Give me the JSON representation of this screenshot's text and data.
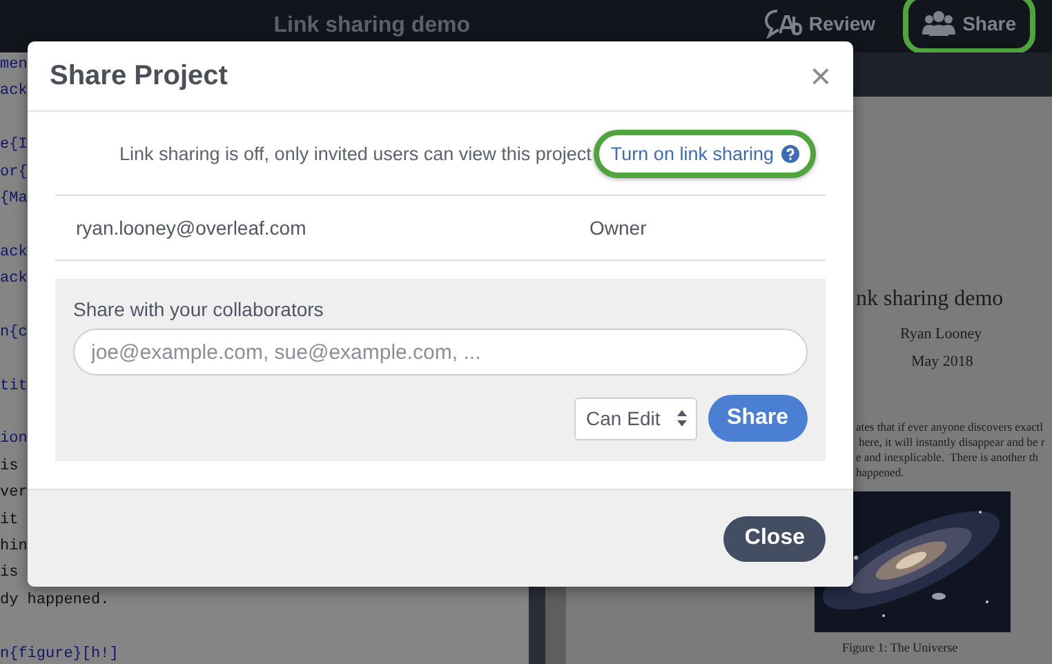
{
  "topbar": {
    "title": "Link sharing demo",
    "buttons": [
      {
        "label": "Review",
        "highlighted": false
      },
      {
        "label": "Share",
        "highlighted": true
      }
    ]
  },
  "editor": {
    "lines": [
      {
        "kind": "command",
        "text": "men"
      },
      {
        "kind": "command",
        "text": "ack"
      },
      {
        "kind": "blank"
      },
      {
        "kind": "command",
        "text": "e{I"
      },
      {
        "kind": "command",
        "text": "or{"
      },
      {
        "kind": "command",
        "text": "{Ma"
      },
      {
        "kind": "blank"
      },
      {
        "kind": "command",
        "text": "ack"
      },
      {
        "kind": "command",
        "text": "ack"
      },
      {
        "kind": "blank"
      },
      {
        "kind": "command",
        "text": "n{c"
      },
      {
        "kind": "blank"
      },
      {
        "kind": "command",
        "text": "tit"
      },
      {
        "kind": "blank"
      },
      {
        "kind": "command",
        "text": "ion"
      },
      {
        "kind": "text",
        "text": "is"
      },
      {
        "kind": "text",
        "text": "ver"
      },
      {
        "kind": "text",
        "text": "it"
      },
      {
        "kind": "text",
        "text": "hin"
      },
      {
        "kind": "text",
        "text": "is"
      },
      {
        "kind": "text",
        "text": "dy happened."
      },
      {
        "kind": "blank"
      },
      {
        "kind": "command",
        "text": "n{figure}[h!]"
      }
    ]
  },
  "pdf": {
    "title": "nk sharing demo",
    "author": "Ryan Looney",
    "date": "May 2018",
    "paragraph_lines": [
      "ates that if ever anyone discovers exactl",
      " here, it will instantly disappear and be r",
      "e and inexplicable.  There is another th",
      "happened."
    ],
    "figure": {
      "kind": "picture",
      "caption": "Figure 1: The Universe"
    }
  },
  "dialog": {
    "title": "Share Project",
    "close_icon": "×",
    "link_sharing": {
      "text": "Link sharing is off, only invited users can view this project",
      "link": "Turn on link sharing",
      "highlighted": true
    },
    "members": [
      {
        "email": "ryan.looney@overleaf.com",
        "role": "Owner"
      }
    ],
    "invite": {
      "label": "Share with your collaborators",
      "placeholder": "joe@example.com, sue@example.com, ...",
      "permission": "Can Edit",
      "button": "Share"
    },
    "footer_button": "Close"
  }
}
